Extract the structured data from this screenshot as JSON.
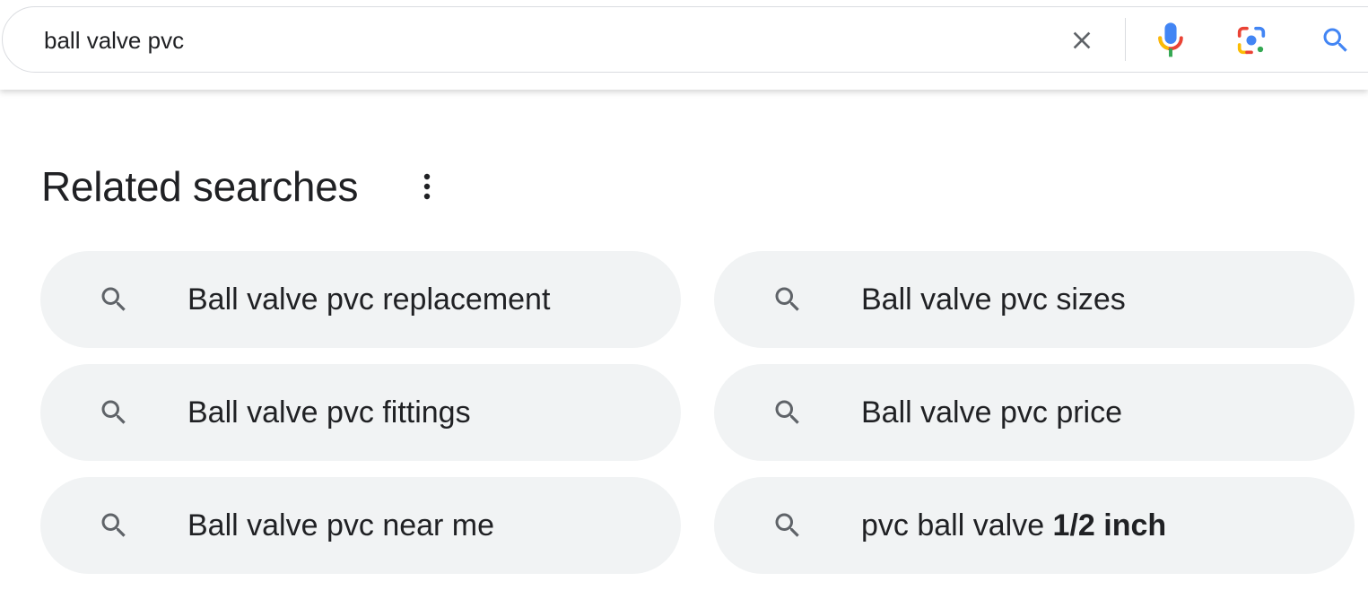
{
  "search": {
    "query": "ball valve pvc"
  },
  "icons": {
    "clear": "close-icon",
    "voice": "microphone-icon",
    "lens": "lens-camera-icon",
    "submit": "search-icon",
    "more": "more-vert-icon",
    "suggestion": "search-icon"
  },
  "colors": {
    "mic_blue": "#4285f4",
    "mic_red": "#ea4335",
    "mic_yellow": "#fbbc04",
    "mic_green": "#34a853",
    "search_blue": "#4285f4",
    "chip_bg": "#f1f3f4"
  },
  "related": {
    "title": "Related searches",
    "items": [
      {
        "text": "Ball valve pvc replacement",
        "bold": ""
      },
      {
        "text": "Ball valve pvc sizes",
        "bold": ""
      },
      {
        "text": "Ball valve pvc fittings",
        "bold": ""
      },
      {
        "text": "Ball valve pvc price",
        "bold": ""
      },
      {
        "text": "Ball valve pvc near me",
        "bold": ""
      },
      {
        "text": "pvc ball valve ",
        "bold": "1/2 inch"
      }
    ]
  }
}
